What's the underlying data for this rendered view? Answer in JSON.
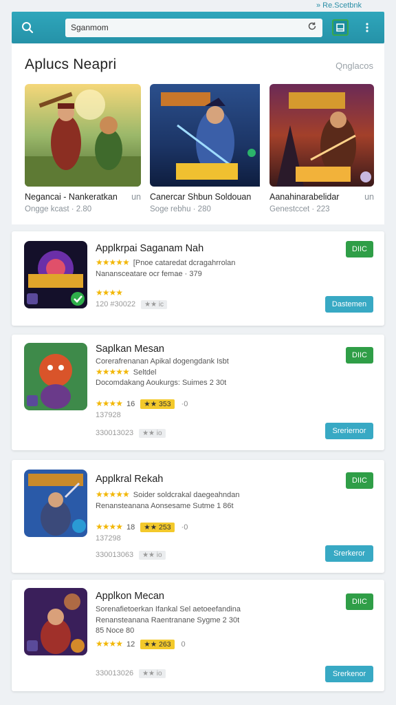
{
  "top_note": "» Re.Scetbnk",
  "toolbar": {
    "search_value": "Sganmom",
    "search_icon": "search-icon",
    "refresh_icon": "refresh-icon",
    "bookmark_icon": "bookmark-icon",
    "menu_icon": "more-vertical-icon"
  },
  "featured": {
    "title": "Aplucs Neapri",
    "link": "Qnglacos",
    "cards": [
      {
        "name": "Negancai - Nankeratkan",
        "suffix": "un",
        "sub": "Ongge kcast · 2.80"
      },
      {
        "name": "Canercar Shbun Soldouan",
        "suffix": "",
        "sub": "Soge rebhu · 280"
      },
      {
        "name": "Aanahinarabelidar",
        "suffix": "un",
        "sub": "Genestccet · 223"
      }
    ]
  },
  "apps": [
    {
      "title": "Applkrpai Saganam Nah",
      "line1": "[Pnoe cataredat dcragahrrolan",
      "line2": "Nanansceatare ocr femae · 379",
      "stars_text": "★★★★",
      "line4": "120 #30022",
      "pill_gray": "★★ ic",
      "badge": "DIIC",
      "button": "Dastemen"
    },
    {
      "title": "Saplkan Mesan",
      "line1": "Corerafrenanan Apikal dogengdank Isbt",
      "line1b": "Seltdel",
      "line2": "Docomdakang Aoukurgs: Suimes 2 30t",
      "rating_count": "16",
      "pill_yellow": "★★ 353",
      "dot": "·0",
      "line4": "137928",
      "line5": "330013023",
      "pill_gray": "★★ io",
      "badge": "DIIC",
      "button": "Sreriernor"
    },
    {
      "title": "Applkral Rekah",
      "line1": "Soider soldcrakal daegeahndan",
      "line2": "Renansteanana Aonsesame Sutme 1 86t",
      "rating_count": "18",
      "pill_yellow": "★★ 253",
      "dot": "·0",
      "line4": "137298",
      "line5": "330013063",
      "pill_gray": "★★ io",
      "badge": "DIIC",
      "button": "Srerkeror"
    },
    {
      "title": "Applkon Mecan",
      "line1": "Sorenafietoerkan Ifankal Sel aetoeefandina",
      "line2": "Renansteanana Raentranane Sygme 2 30t",
      "line3": "85 Noce 80",
      "rating_count": "12",
      "pill_yellow": "★★ 263",
      "dot": "0",
      "line5": "330013026",
      "pill_gray": "★★ io",
      "badge": "DIIC",
      "button": "Srerkenor"
    }
  ],
  "colors": {
    "topbar": "#2592a8",
    "badge_green": "#2f9e47",
    "button_blue": "#38a9c4",
    "star": "#f2b707"
  }
}
